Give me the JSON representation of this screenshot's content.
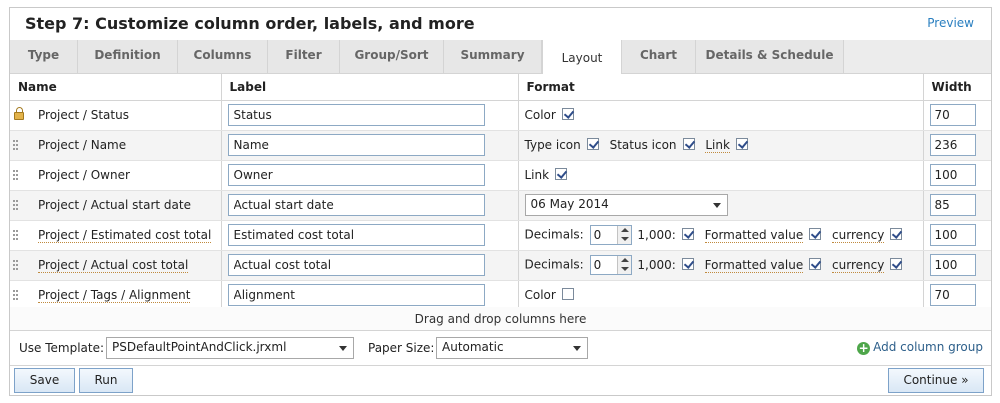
{
  "header": {
    "title": "Step 7: Customize column order, labels, and more",
    "preview_label": "Preview"
  },
  "tabs": [
    {
      "label": "Type",
      "active": false
    },
    {
      "label": "Definition",
      "active": false
    },
    {
      "label": "Columns",
      "active": false
    },
    {
      "label": "Filter",
      "active": false
    },
    {
      "label": "Group/Sort",
      "active": false
    },
    {
      "label": "Summary",
      "active": false
    },
    {
      "label": "Layout",
      "active": true
    },
    {
      "label": "Chart",
      "active": false
    },
    {
      "label": "Details & Schedule",
      "active": false
    }
  ],
  "table": {
    "headers": {
      "name": "Name",
      "label": "Label",
      "format": "Format",
      "width": "Width"
    },
    "rows": [
      {
        "name": "Project / Status",
        "label": "Status",
        "width": "70",
        "format": {
          "color_label": "Color",
          "color_checked": true
        }
      },
      {
        "name": "Project / Name",
        "label": "Name",
        "width": "236",
        "format": {
          "type_icon_label": "Type icon",
          "status_icon_label": "Status icon",
          "link_label": "Link"
        }
      },
      {
        "name": "Project / Owner",
        "label": "Owner",
        "width": "100",
        "format": {
          "link_label": "Link"
        }
      },
      {
        "name": "Project / Actual start date",
        "label": "Actual start date",
        "width": "85",
        "format": {
          "date_format": "06 May 2014"
        }
      },
      {
        "name": "Project / Estimated cost total",
        "label": "Estimated cost total",
        "width": "100",
        "format": {
          "decimals_label": "Decimals:",
          "decimals_value": "0",
          "thousands_label": "1,000:",
          "formatted_label": "Formatted value",
          "currency_label": "currency"
        }
      },
      {
        "name": "Project / Actual cost total",
        "label": "Actual cost total",
        "width": "100",
        "format": {
          "decimals_label": "Decimals:",
          "decimals_value": "0",
          "thousands_label": "1,000:",
          "formatted_label": "Formatted value",
          "currency_label": "currency"
        }
      },
      {
        "name": "Project / Tags / Alignment",
        "label": "Alignment",
        "width": "70",
        "format": {
          "color_label": "Color",
          "color_checked": false
        }
      }
    ]
  },
  "dropzone": {
    "text": "Drag and drop columns here"
  },
  "template_bar": {
    "template_label": "Use Template:",
    "template_value": "PSDefaultPointAndClick.jrxml",
    "paper_label": "Paper Size:",
    "paper_value": "Automatic",
    "add_group_label": "Add column group"
  },
  "buttons": {
    "save": "Save",
    "run": "Run",
    "continue": "Continue »"
  },
  "colors": {
    "link": "#2a7fc0",
    "input_border": "#8da9c4",
    "button_border": "#7da2c9"
  },
  "icons": [
    "lock-icon",
    "drag-handle-icon",
    "add-circle-icon",
    "dropdown-arrow-icon",
    "checkbox-icon",
    "spinner-arrows-icon"
  ]
}
